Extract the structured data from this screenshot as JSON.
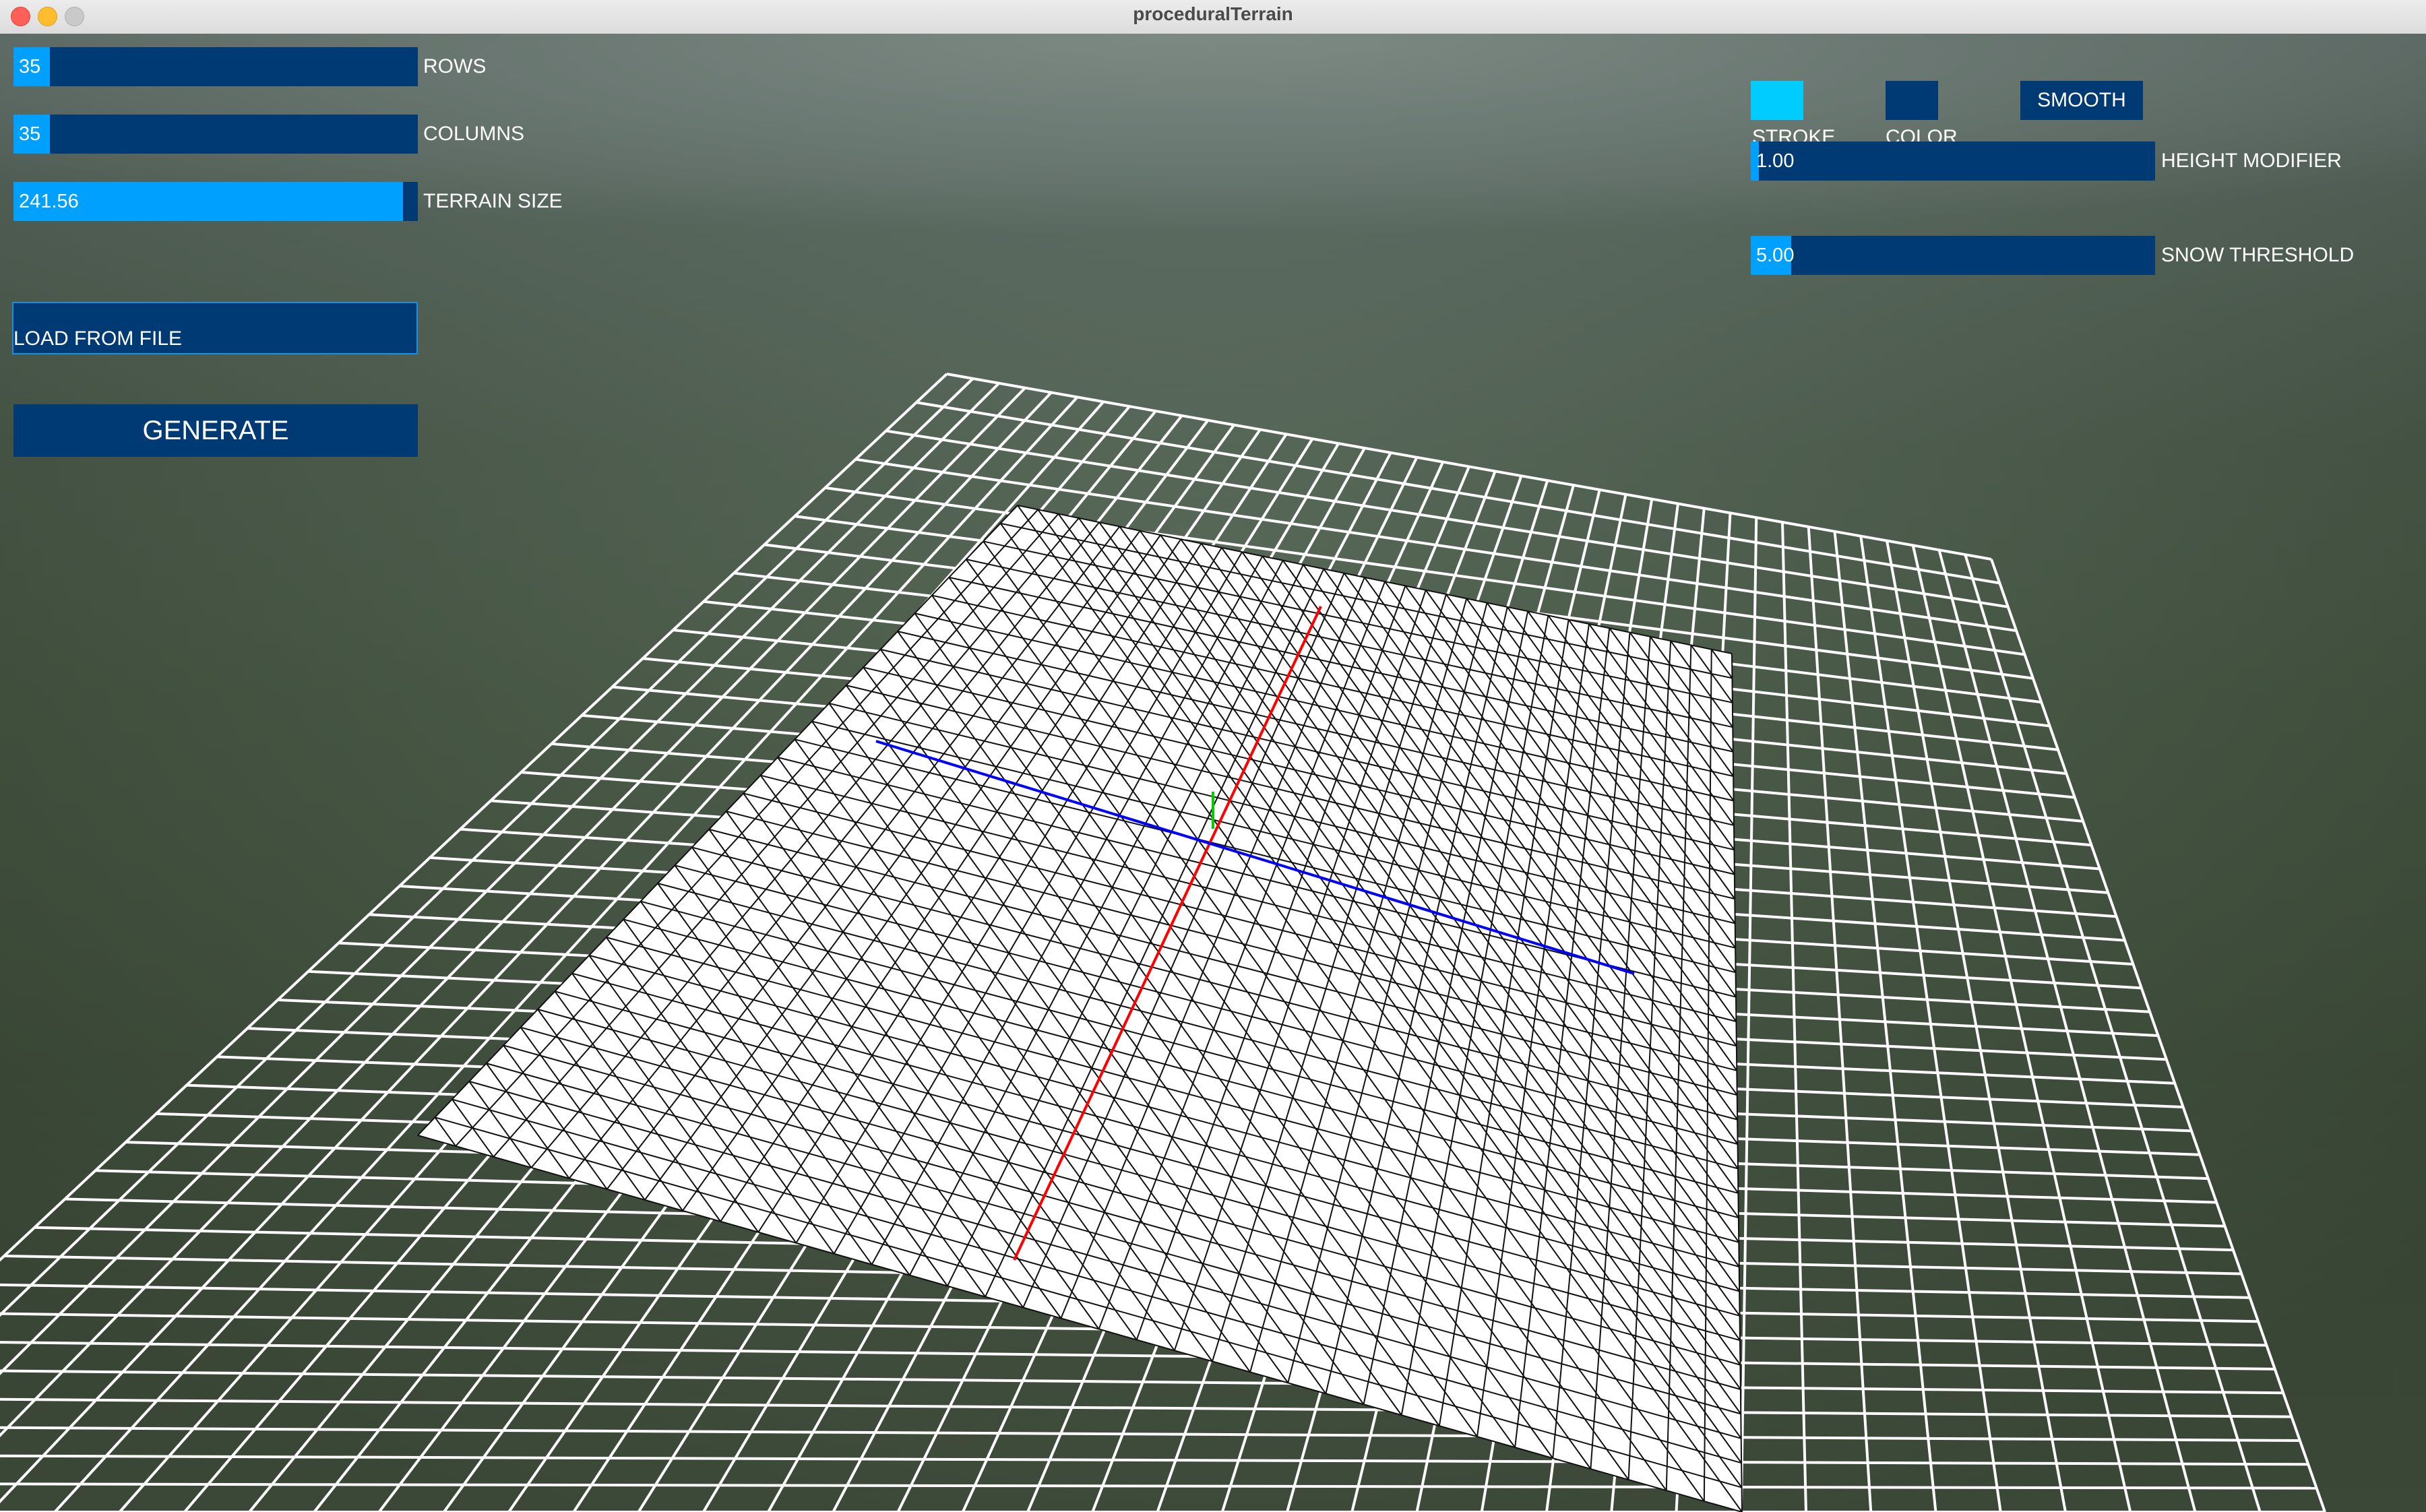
{
  "window": {
    "title": "proceduralTerrain"
  },
  "left_panel": {
    "rows": {
      "label": "ROWS",
      "value": "35",
      "fraction": 0.09
    },
    "columns": {
      "label": "COLUMNS",
      "value": "35",
      "fraction": 0.09
    },
    "terrain_size": {
      "label": "TERRAIN SIZE",
      "value": "241.56",
      "fraction": 0.97
    },
    "load_from_file": {
      "label": "LOAD FROM FILE",
      "value": ""
    },
    "generate_label": "GENERATE"
  },
  "right_panel": {
    "stroke": {
      "label": "STROKE",
      "color": "#00ccff"
    },
    "color": {
      "label": "COLOR",
      "color": "#003a74"
    },
    "smooth_label": "SMOOTH",
    "height_modifier": {
      "label": "HEIGHT MODIFIER",
      "value": "1.00",
      "fraction": 0.02
    },
    "snow_threshold": {
      "label": "SNOW THRESHOLD",
      "value": "5.00",
      "fraction": 0.1
    }
  },
  "colors": {
    "panel": "#003a74",
    "accent": "#00a0ff",
    "axis_x": "#ff0000",
    "axis_z": "#0000ff",
    "axis_y": "#00cc00"
  }
}
